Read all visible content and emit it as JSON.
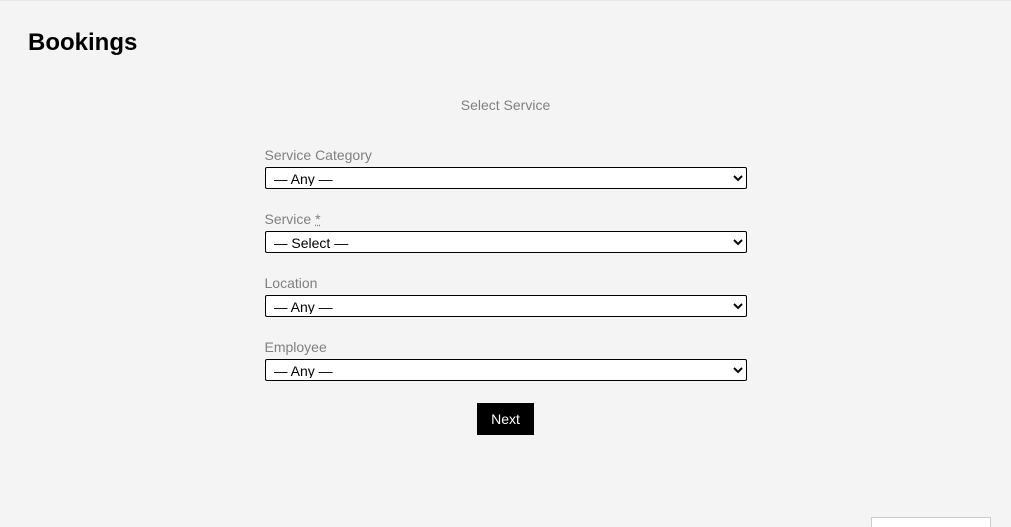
{
  "page": {
    "title": "Bookings"
  },
  "form": {
    "heading": "Select Service",
    "fields": {
      "service_category": {
        "label": "Service Category",
        "selected": "— Any —"
      },
      "service": {
        "label": "Service",
        "required_marker": "*",
        "selected": "— Select —"
      },
      "location": {
        "label": "Location",
        "selected": "— Any —"
      },
      "employee": {
        "label": "Employee",
        "selected": "— Any —"
      }
    },
    "next_button": "Next"
  }
}
